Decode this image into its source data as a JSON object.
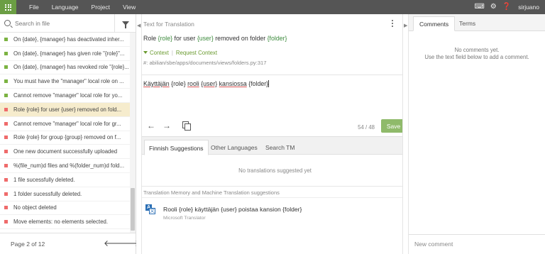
{
  "topbar": {
    "menu": [
      "File",
      "Language",
      "Project",
      "View"
    ],
    "user": "sirjuano",
    "icons": [
      "keyboard-icon",
      "gear-icon",
      "help-icon"
    ]
  },
  "sidebar": {
    "search_placeholder": "Search in file",
    "items": [
      {
        "text": "On {date}, {manager} has deactivated inher...",
        "status": "translated"
      },
      {
        "text": "On {date}, {manager} has given role \"{role}\"...",
        "status": "translated"
      },
      {
        "text": "On {date}, {manager} has revoked role \"{role}...",
        "status": "translated"
      },
      {
        "text": "You must have the \"manager\" local role on ...",
        "status": "translated"
      },
      {
        "text": "Cannot remove \"manager\" local role for yo...",
        "status": "translated"
      },
      {
        "text": "Role {role} for user {user} removed on fold...",
        "status": "untranslated"
      },
      {
        "text": "Cannot remove \"manager\" local role for gr...",
        "status": "untranslated"
      },
      {
        "text": "Role {role} for group {group} removed on f...",
        "status": "untranslated"
      },
      {
        "text": "One new document successfully uploaded",
        "status": "untranslated"
      },
      {
        "text": "%(file_num)d files and %(folder_num)d fold...",
        "status": "untranslated"
      },
      {
        "text": "1 file sucessfully deleted.",
        "status": "untranslated"
      },
      {
        "text": "1 folder sucessfully deleted.",
        "status": "untranslated"
      },
      {
        "text": "No object deleted",
        "status": "untranslated"
      },
      {
        "text": "Move elements: no elements selected.",
        "status": "untranslated"
      }
    ],
    "pager": "Page 2 of 12"
  },
  "editor": {
    "header": "Text for Translation",
    "source_parts": [
      "Role ",
      "{role}",
      " for user ",
      "{user}",
      " removed on folder ",
      "{folder}"
    ],
    "context_label": "Context",
    "request_context_label": "Request Context",
    "path": "#: abilian/sbe/apps/documents/views/folders.py:317",
    "translation_parts": [
      "Käyttäjän",
      " {role} ",
      "rooli",
      " ",
      "{user}",
      " ",
      "kansiossa",
      " {folder}"
    ],
    "count": "54 / 48",
    "save_label": "Save",
    "tabs": [
      "Finnish Suggestions",
      "Other Languages",
      "Search TM"
    ],
    "no_suggestions": "No translations suggested yet",
    "tm_header": "Translation Memory and Machine Translation suggestions",
    "mt_suggestion": "Rooli {role} käyttäjän {user} poistaa kansion {folder}",
    "mt_provider": "Microsoft Translator"
  },
  "comments": {
    "tabs": [
      "Comments",
      "Terms"
    ],
    "empty_line1": "No comments yet.",
    "empty_line2": "Use the text field below to add a comment.",
    "new_comment_placeholder": "New comment"
  },
  "colors": {
    "topbar": "#555555",
    "apps_button": "#6b9e44",
    "translated": "#7cb342",
    "untranslated": "#ef6b6b",
    "selected_row": "#f6eccd",
    "save_button": "#8fba6a"
  }
}
